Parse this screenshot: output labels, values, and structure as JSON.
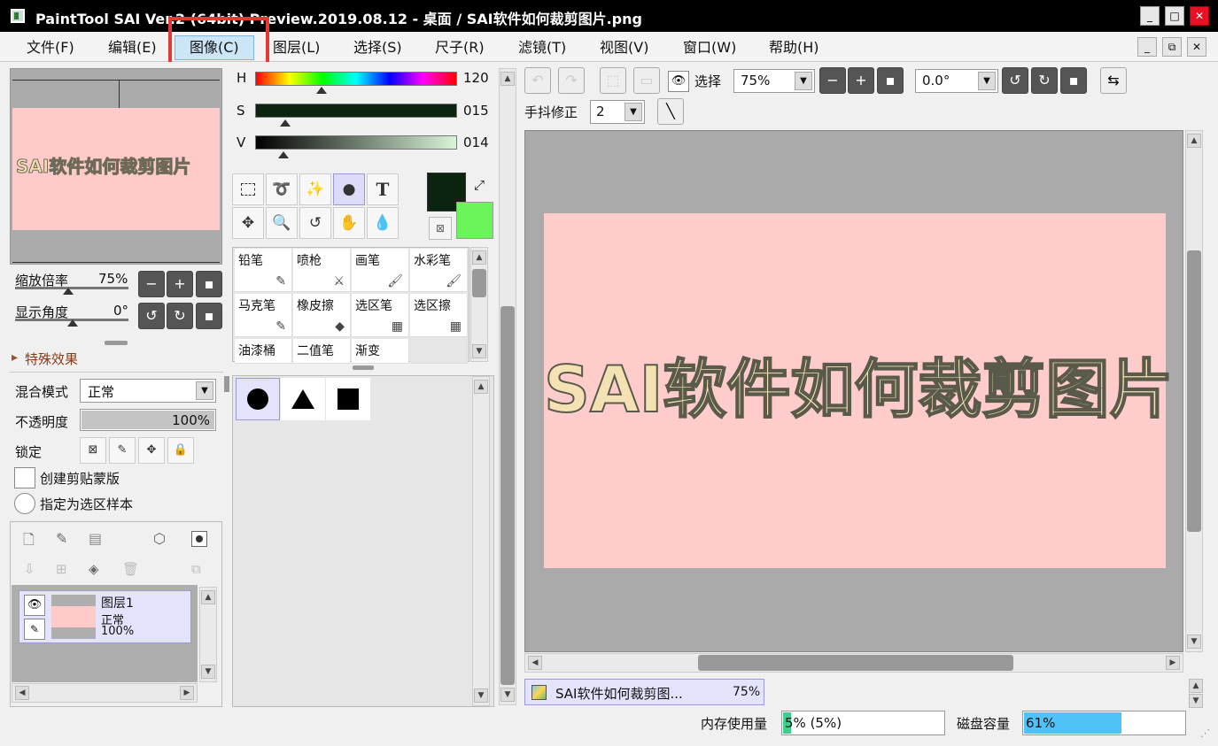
{
  "window": {
    "title": "PaintTool SAI Ver.2 (64bit) Preview.2019.08.12 - 桌面 / SAI软件如何裁剪图片.png",
    "minimize": "_",
    "maximize": "□",
    "close": "✕"
  },
  "menu": {
    "items": [
      "文件(F)",
      "编辑(E)",
      "图像(C)",
      "图层(L)",
      "选择(S)",
      "尺子(R)",
      "滤镜(T)",
      "视图(V)",
      "窗口(W)",
      "帮助(H)"
    ],
    "active": "图像(C)"
  },
  "navigator": {
    "zoom_label": "缩放倍率",
    "zoom_value": "75%",
    "angle_label": "显示角度",
    "angle_value": "0°",
    "preview_text": "SAI软件如何裁剪图片"
  },
  "effects": {
    "label": "特殊效果"
  },
  "layer_props": {
    "blend_label": "混合模式",
    "blend_value": "正常",
    "opacity_label": "不透明度",
    "opacity_value": "100%",
    "opacity_fraction": 1.0,
    "lock_label": "锁定",
    "clip_label": "创建剪贴蒙版",
    "sample_label": "指定为选区样本"
  },
  "layers": [
    {
      "name": "图层1",
      "mode": "正常",
      "opacity": "100%"
    }
  ],
  "color": {
    "h_label": "H",
    "h_value": "120",
    "h_fraction": 0.33,
    "s_label": "S",
    "s_value": "015",
    "s_fraction": 0.15,
    "v_label": "V",
    "v_value": "014",
    "v_fraction": 0.14,
    "primary": "#0b2410",
    "secondary": "#6cf55a"
  },
  "brushes": [
    {
      "label": "铅笔",
      "icon": "pencil-icon",
      "glyph": "✎"
    },
    {
      "label": "喷枪",
      "icon": "airbrush-icon",
      "glyph": "⚔"
    },
    {
      "label": "画笔",
      "icon": "brush-icon",
      "glyph": "🖌"
    },
    {
      "label": "水彩笔",
      "icon": "watercolor-icon",
      "glyph": "🖌"
    },
    {
      "label": "马克笔",
      "icon": "marker-icon",
      "glyph": "✎"
    },
    {
      "label": "橡皮擦",
      "icon": "eraser-icon",
      "glyph": "◆"
    },
    {
      "label": "选区笔",
      "icon": "select-pen-icon",
      "glyph": "▦"
    },
    {
      "label": "选区擦",
      "icon": "select-eraser-icon",
      "glyph": "▦"
    },
    {
      "label": "油漆桶",
      "icon": "",
      "glyph": ""
    },
    {
      "label": "二值笔",
      "icon": "",
      "glyph": ""
    },
    {
      "label": "渐变",
      "icon": "",
      "glyph": ""
    }
  ],
  "toolbar": {
    "select_label": "选择",
    "zoom_value": "75%",
    "angle_value": "0.0°",
    "stabilizer_label": "手抖修正",
    "stabilizer_value": "2"
  },
  "canvas": {
    "text": "SAI软件如何裁剪图片",
    "background": "#ffcccc"
  },
  "tabs": [
    {
      "label": "SAI软件如何裁剪图...",
      "zoom": "75%"
    }
  ],
  "status": {
    "memory_label": "内存使用量",
    "memory_value": "5% (5%)",
    "memory_fraction": 0.05,
    "disk_label": "磁盘容量",
    "disk_value": "61%",
    "disk_fraction": 0.61
  }
}
